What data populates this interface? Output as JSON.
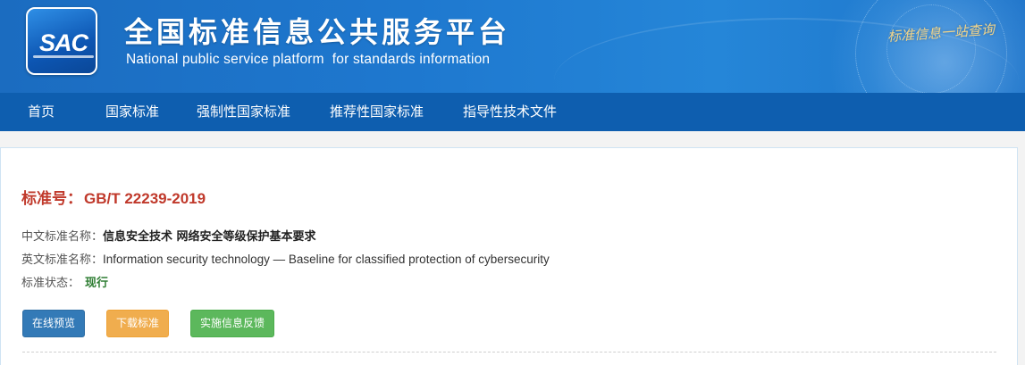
{
  "header": {
    "logo_text": "SAC",
    "title": "全国标准信息公共服务平台",
    "subtitle": "National public service platform  for standards information",
    "slogan": "标准信息一站查询"
  },
  "nav": {
    "items": [
      {
        "label": "首页"
      },
      {
        "label": "国家标准"
      },
      {
        "label": "强制性国家标准"
      },
      {
        "label": "推荐性国家标准"
      },
      {
        "label": "指导性技术文件"
      }
    ]
  },
  "standard": {
    "number_label": "标准号：",
    "number": "GB/T 22239-2019",
    "cn_name_label": "中文标准名称：",
    "cn_name": "信息安全技术 网络安全等级保护基本要求",
    "en_name_label": "英文标准名称：",
    "en_name": "Information security technology — Baseline for classified protection of cybersecurity",
    "status_label": "标准状态：",
    "status": "现行"
  },
  "actions": {
    "preview": "在线预览",
    "download": "下载标准",
    "feedback": "实施信息反馈"
  },
  "colors": {
    "banner": "#1e78cf",
    "nav": "#0e5eaf",
    "std_number": "#c0392b",
    "status": "#2e7d32",
    "btn_preview": "#337ab7",
    "btn_download": "#f0ad4e",
    "btn_feedback": "#5cb85c"
  }
}
